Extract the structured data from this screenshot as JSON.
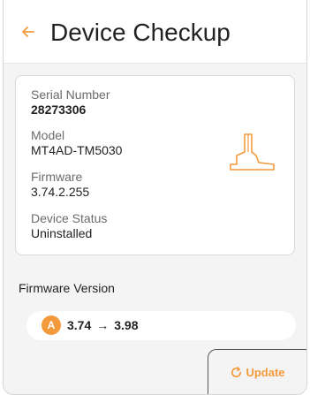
{
  "header": {
    "title": "Device Checkup",
    "back_icon": "back-arrow-icon"
  },
  "device_info": {
    "serial_label": "Serial Number",
    "serial_value": "28273306",
    "model_label": "Model",
    "model_value": "MT4AD-TM5030",
    "firmware_label": "Firmware",
    "firmware_value": "3.74.2.255",
    "status_label": "Device Status",
    "status_value": "Uninstalled",
    "device_icon": "tool-device-icon"
  },
  "firmware_update": {
    "title": "Firmware Version",
    "badge": "A",
    "current_version": "3.74",
    "arrow": "→",
    "new_version": "3.98"
  },
  "actions": {
    "update_label": "Update",
    "update_icon": "refresh-icon"
  },
  "colors": {
    "accent": "#f39a3c",
    "background": "#f4f4f4",
    "card": "#ffffff"
  }
}
